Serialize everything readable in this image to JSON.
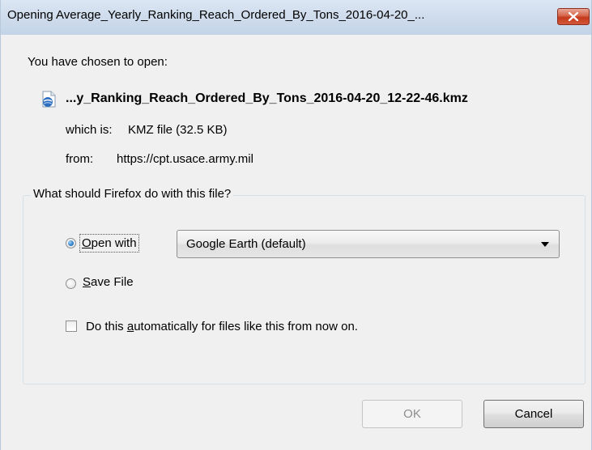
{
  "window": {
    "title": "Opening Average_Yearly_Ranking_Reach_Ordered_By_Tons_2016-04-20_..."
  },
  "dialog": {
    "chosen_label": "You have chosen to open:",
    "filename": "...y_Ranking_Reach_Ordered_By_Tons_2016-04-20_12-22-46.kmz",
    "which_is_label": "which is:",
    "which_is_value": "KMZ file (32.5 KB)",
    "from_label": "from:",
    "from_value": "https://cpt.usace.army.mil",
    "group_title": "What should Firefox do with this file?",
    "open_with": {
      "prefix": "",
      "accel": "O",
      "rest": "pen with",
      "checked": true
    },
    "app_dropdown": {
      "selected": "Google Earth (default)"
    },
    "save_file": {
      "accel": "S",
      "rest": "ave File",
      "checked": false
    },
    "auto_checkbox": {
      "prefix": "Do this ",
      "accel": "a",
      "rest": "utomatically for files like this from now on.",
      "checked": false
    },
    "ok_label": "OK",
    "cancel_label": "Cancel"
  },
  "icons": {
    "close": "close-icon",
    "file": "kmz-file-icon",
    "dropdown": "chevron-down-icon"
  },
  "colors": {
    "close_button": "#c4391b",
    "radio_selected": "#2e7cc4",
    "disabled_text": "#8d8d8d"
  }
}
